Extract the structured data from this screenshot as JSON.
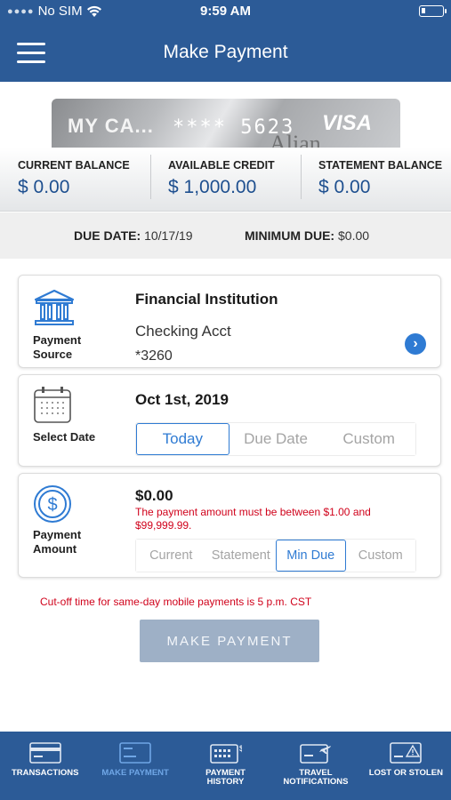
{
  "status_bar": {
    "carrier": "No SIM",
    "time": "9:59 AM"
  },
  "header": {
    "title": "Make Payment"
  },
  "card": {
    "name": "MY CA...",
    "number": "**** 5623",
    "brand": "VISA",
    "ghost_text": "Alian"
  },
  "balances": [
    {
      "label": "CURRENT BALANCE",
      "value": "$ 0.00"
    },
    {
      "label": "AVAILABLE CREDIT",
      "value": "$ 1,000.00"
    },
    {
      "label": "STATEMENT BALANCE",
      "value": "$ 0.00"
    }
  ],
  "due": {
    "date_label": "DUE DATE:",
    "date": "10/17/19",
    "min_label": "MINIMUM DUE:",
    "min": "$0.00"
  },
  "payment_source": {
    "label_line1": "Payment",
    "label_line2": "Source",
    "title": "Financial Institution",
    "account_type": "Checking Acct",
    "account_number": "*3260"
  },
  "select_date": {
    "label": "Select Date",
    "value": "Oct 1st, 2019",
    "options": [
      "Today",
      "Due Date",
      "Custom"
    ],
    "selected": "Today"
  },
  "payment_amount": {
    "label_line1": "Payment",
    "label_line2": "Amount",
    "value": "$0.00",
    "error_line1": "The payment amount must be between $1.00 and",
    "error_line2": "$99,999.99.",
    "options": [
      "Current",
      "Statement",
      "Min Due",
      "Custom"
    ],
    "selected": "Min Due"
  },
  "cutoff_notice": "Cut-off time for same-day mobile payments is 5 p.m. CST",
  "make_payment_button": "MAKE PAYMENT",
  "tabs": [
    {
      "line1": "TRANSACTIONS",
      "line2": "",
      "icon": "transactions-card-icon"
    },
    {
      "line1": "MAKE PAYMENT",
      "line2": "",
      "icon": "payment-card-icon",
      "active": true
    },
    {
      "line1": "PAYMENT",
      "line2": "HISTORY",
      "icon": "payment-history-icon"
    },
    {
      "line1": "TRAVEL",
      "line2": "NOTIFICATIONS",
      "icon": "travel-card-icon"
    },
    {
      "line1": "LOST OR STOLEN",
      "line2": "",
      "icon": "lost-card-warning-icon"
    }
  ],
  "colors": {
    "brand": "#2c5b97",
    "accent": "#2f7bd3",
    "error": "#d0021b",
    "button_disabled": "#9eb0c6",
    "tab_active": "#6fa6e6"
  }
}
